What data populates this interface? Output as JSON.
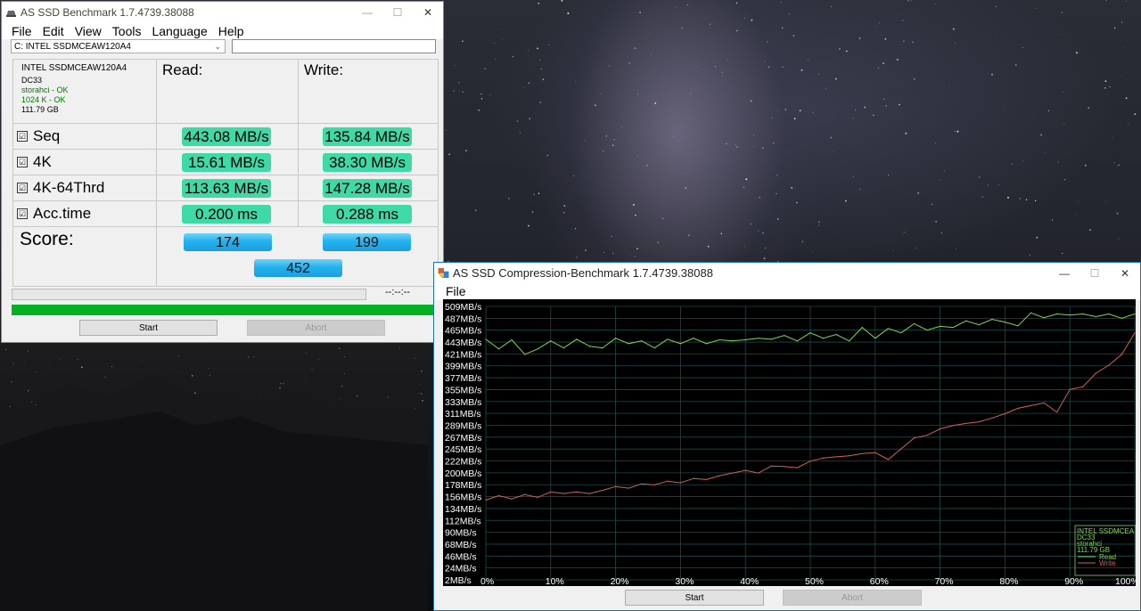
{
  "main_window": {
    "title": "AS SSD Benchmark 1.7.4739.38088",
    "menu": [
      "File",
      "Edit",
      "View",
      "Tools",
      "Language",
      "Help"
    ],
    "drive_select": "C: INTEL SSDMCEAW120A4",
    "drive_info": {
      "model": "INTEL SSDMCEAW120A4",
      "firmware": "DC33",
      "driver": "storahci - OK",
      "alignment": "1024 K - OK",
      "size": "111.79 GB"
    },
    "col_read": "Read:",
    "col_write": "Write:",
    "rows": [
      {
        "label": "Seq",
        "read": "443.08 MB/s",
        "write": "135.84 MB/s"
      },
      {
        "label": "4K",
        "read": "15.61 MB/s",
        "write": "38.30 MB/s"
      },
      {
        "label": "4K-64Thrd",
        "read": "113.63 MB/s",
        "write": "147.28 MB/s"
      },
      {
        "label": "Acc.time",
        "read": "0.200 ms",
        "write": "0.288 ms"
      }
    ],
    "checkbox_mark": "☑",
    "score_label": "Score:",
    "score_read": "174",
    "score_write": "199",
    "score_total": "452",
    "time_display": "--:--:--",
    "start": "Start",
    "abort": "Abort"
  },
  "comp_window": {
    "title": "AS SSD Compression-Benchmark 1.7.4739.38088",
    "menu": [
      "File"
    ],
    "start": "Start",
    "abort": "Abort"
  },
  "chart_data": {
    "type": "line",
    "ylim": [
      2,
      509
    ],
    "y_ticks": [
      "509MB/s",
      "487MB/s",
      "465MB/s",
      "443MB/s",
      "421MB/s",
      "399MB/s",
      "377MB/s",
      "355MB/s",
      "333MB/s",
      "311MB/s",
      "289MB/s",
      "267MB/s",
      "245MB/s",
      "222MB/s",
      "200MB/s",
      "178MB/s",
      "156MB/s",
      "134MB/s",
      "112MB/s",
      "90MB/s",
      "68MB/s",
      "46MB/s",
      "24MB/s",
      "2MB/s"
    ],
    "x_ticks": [
      "0%",
      "10%",
      "20%",
      "30%",
      "40%",
      "50%",
      "60%",
      "70%",
      "80%",
      "90%",
      "100%"
    ],
    "legend_info": [
      "INTEL SSDMCEA",
      "DC33",
      "storahci",
      "111.79 GB"
    ],
    "series": [
      {
        "name": "Read",
        "color": "#7fd650",
        "x": [
          0,
          2,
          4,
          6,
          8,
          10,
          12,
          14,
          16,
          18,
          20,
          22,
          24,
          26,
          28,
          30,
          32,
          34,
          36,
          38,
          40,
          42,
          44,
          46,
          48,
          50,
          52,
          54,
          56,
          58,
          60,
          62,
          64,
          66,
          68,
          70,
          72,
          74,
          76,
          78,
          80,
          82,
          84,
          86,
          88,
          90,
          92,
          94,
          96,
          98,
          100
        ],
        "values": [
          448,
          430,
          447,
          420,
          430,
          445,
          432,
          448,
          435,
          432,
          450,
          440,
          445,
          432,
          448,
          440,
          450,
          440,
          447,
          445,
          447,
          450,
          448,
          455,
          445,
          460,
          450,
          457,
          445,
          470,
          450,
          468,
          460,
          477,
          465,
          472,
          470,
          482,
          475,
          485,
          480,
          473,
          497,
          488,
          495,
          493,
          495,
          490,
          495,
          487,
          495
        ]
      },
      {
        "name": "Write",
        "color": "#d06060",
        "x": [
          0,
          2,
          4,
          6,
          8,
          10,
          12,
          14,
          16,
          18,
          20,
          22,
          24,
          26,
          28,
          30,
          32,
          34,
          36,
          38,
          40,
          42,
          44,
          46,
          48,
          50,
          52,
          54,
          56,
          58,
          60,
          62,
          64,
          66,
          68,
          70,
          72,
          74,
          76,
          78,
          80,
          82,
          84,
          86,
          88,
          90,
          92,
          94,
          96,
          98,
          100
        ],
        "values": [
          150,
          158,
          152,
          160,
          155,
          165,
          162,
          165,
          162,
          168,
          175,
          172,
          180,
          178,
          185,
          182,
          190,
          188,
          195,
          200,
          205,
          200,
          213,
          212,
          210,
          222,
          228,
          230,
          232,
          236,
          238,
          225,
          245,
          265,
          270,
          282,
          288,
          292,
          295,
          302,
          310,
          320,
          325,
          330,
          313,
          355,
          360,
          385,
          400,
          420,
          460
        ]
      }
    ]
  }
}
